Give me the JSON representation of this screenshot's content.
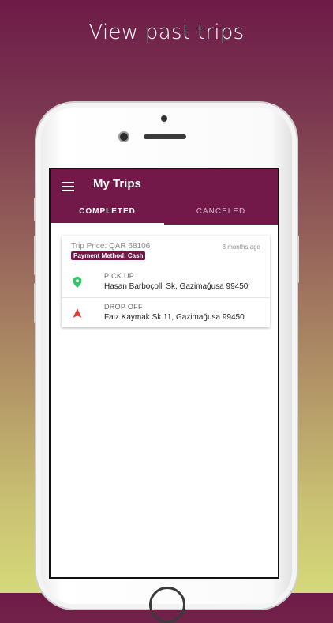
{
  "headline": "View past trips",
  "app": {
    "title": "My Trips",
    "tabs": [
      {
        "label": "COMPLETED",
        "active": true
      },
      {
        "label": "CANCELED",
        "active": false
      }
    ]
  },
  "trip": {
    "price": "Trip Price: QAR 68106",
    "time_ago": "8 months ago",
    "payment_method": "Payment Method: Cash",
    "pickup_label": "PICK UP",
    "pickup_address": "Hasan Barboçolli Sk, Gazimağusa 99450",
    "dropoff_label": "DROP OFF",
    "dropoff_address": "Faiz Kaymak Sk 11, Gazimağusa 99450"
  },
  "colors": {
    "primary": "#72194a",
    "pickup_icon": "#2ec866",
    "dropoff_icon": "#e53935"
  }
}
